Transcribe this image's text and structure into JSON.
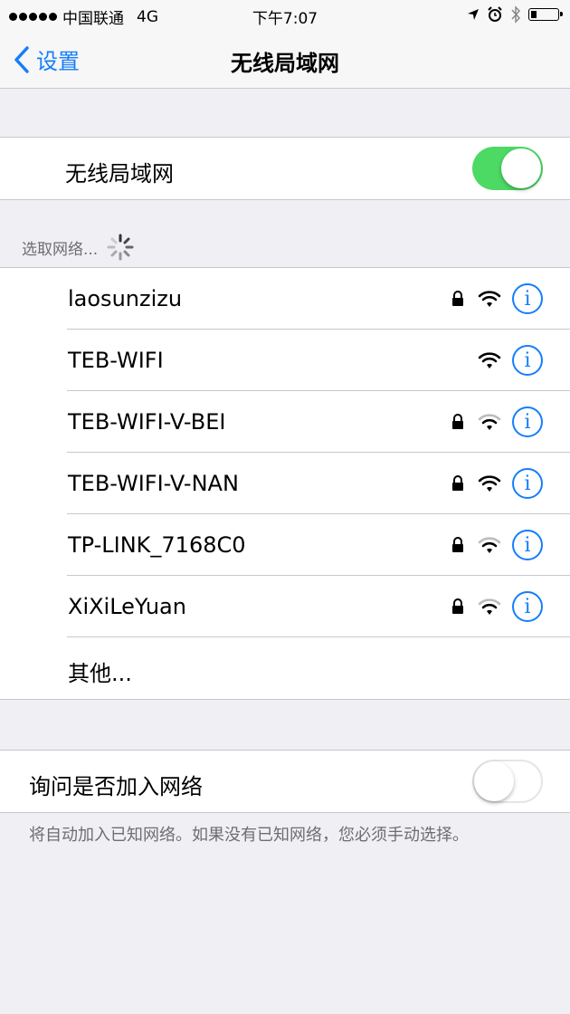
{
  "status_bar": {
    "carrier": "中国联通",
    "network": "4G",
    "time": "下午7:07"
  },
  "nav": {
    "back_label": "设置",
    "title": "无线局域网"
  },
  "wifi_toggle": {
    "label": "无线局域网",
    "on": true
  },
  "networks_header": "选取网络...",
  "networks": [
    {
      "name": "laosunzizu",
      "locked": true
    },
    {
      "name": "TEB-WIFI",
      "locked": false
    },
    {
      "name": "TEB-WIFI-V-BEI",
      "locked": true
    },
    {
      "name": "TEB-WIFI-V-NAN",
      "locked": true
    },
    {
      "name": "TP-LINK_7168C0",
      "locked": true
    },
    {
      "name": "XiXiLeYuan",
      "locked": true
    }
  ],
  "other_label": "其他...",
  "ask_join": {
    "label": "询问是否加入网络",
    "on": false,
    "note": "将自动加入已知网络。如果没有已知网络，您必须手动选择。"
  },
  "icons": {
    "info_glyph": "i"
  },
  "colors": {
    "accent": "#157efb",
    "toggle_on": "#4cd964",
    "background": "#efeff4"
  }
}
